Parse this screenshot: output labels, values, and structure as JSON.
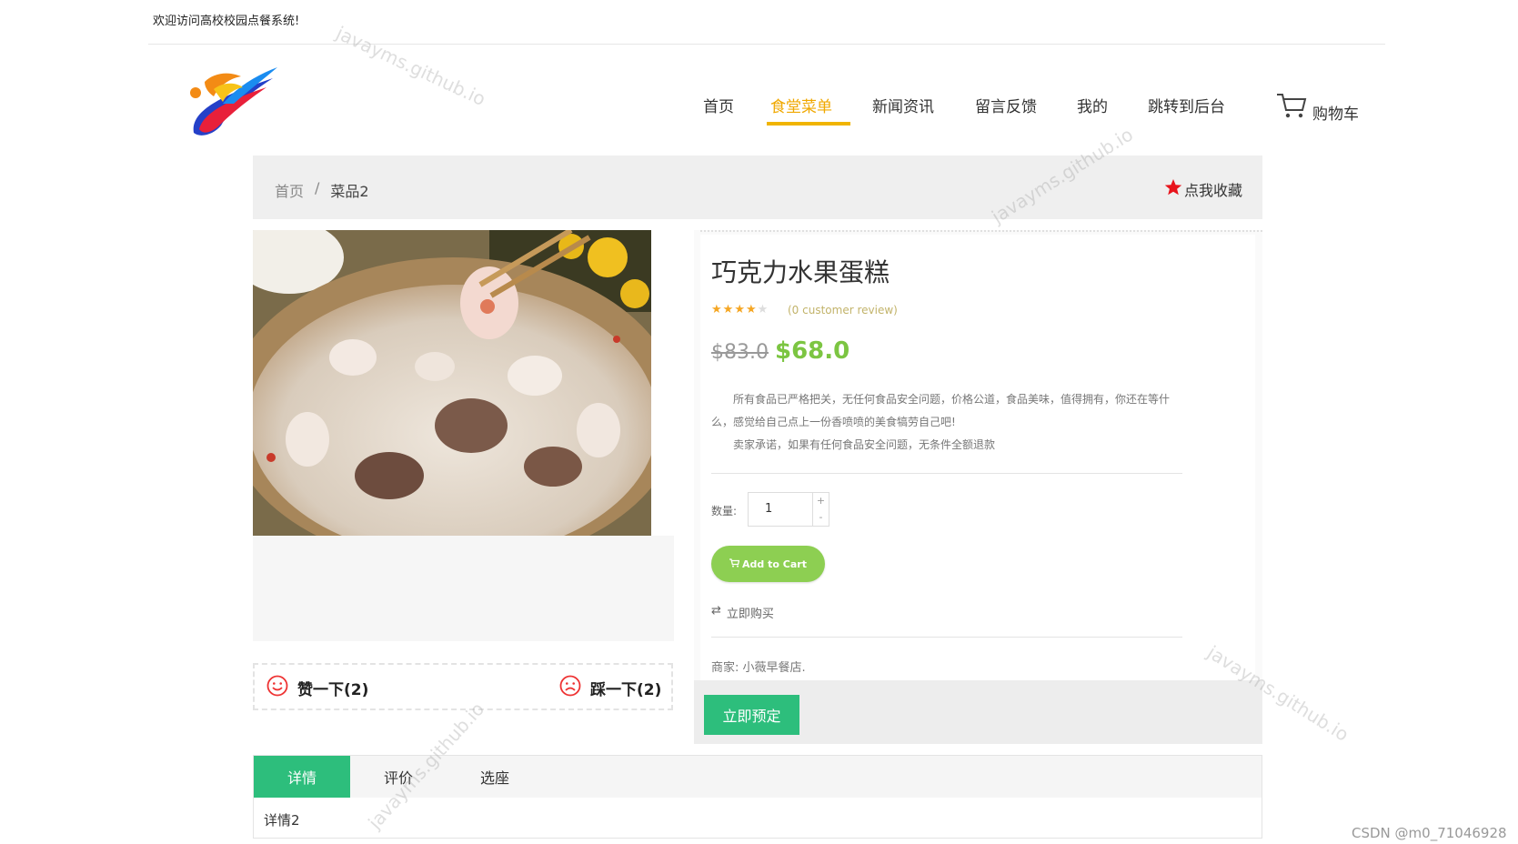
{
  "top": {
    "welcome": "欢迎访问高校校园点餐系统!"
  },
  "nav": {
    "items": [
      {
        "label": "首页",
        "active": false
      },
      {
        "label": "食堂菜单",
        "active": true
      },
      {
        "label": "新闻资讯",
        "active": false
      },
      {
        "label": "留言反馈",
        "active": false
      },
      {
        "label": "我的",
        "active": false
      },
      {
        "label": "跳转到后台",
        "active": false
      }
    ],
    "cart_label": "购物车",
    "active_color": "#f0a800"
  },
  "breadcrumb": {
    "home": "首页",
    "separator": "/",
    "current": "菜品2"
  },
  "favorite": {
    "label": "点我收藏",
    "icon": "star-icon"
  },
  "product": {
    "title": "巧克力水果蛋糕",
    "rating": 4,
    "rating_max": 5,
    "review_text": "(0 customer review)",
    "old_price": "$83.0",
    "new_price": "$68.0",
    "desc_line1": "所有食品已严格把关，无任何食品安全问题，价格公道，食品美味，值得拥有，你还在等什么，感觉给自己点上一份香喷喷的美食犒劳自己吧!",
    "desc_line2": "卖家承诺，如果有任何食品安全问题，无条件全额退款",
    "qty_label": "数量:",
    "qty_value": "1",
    "qty_plus": "+",
    "qty_minus": "-",
    "add_to_cart": "Add to Cart",
    "buy_now": "立即购买",
    "seller": "商家: 小薇早餐店.",
    "reserve": "立即预定"
  },
  "votes": {
    "like": "赞一下(2)",
    "dislike": "踩一下(2)"
  },
  "tabs": {
    "items": [
      {
        "label": "详情",
        "active": true
      },
      {
        "label": "评价",
        "active": false
      },
      {
        "label": "选座",
        "active": false
      }
    ],
    "content": "详情2",
    "accent": "#2dbe7c"
  },
  "watermark": "javayms.github.io",
  "credit": "CSDN @m0_71046928"
}
